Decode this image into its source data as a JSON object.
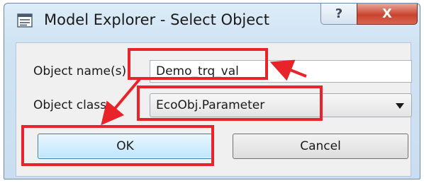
{
  "window": {
    "title": "Model Explorer - Select Object",
    "help_glyph": "?",
    "close_glyph": "X"
  },
  "form": {
    "name_label": "Object name(s):",
    "name_value": "Demo_trq_val",
    "class_label": "Object class:",
    "class_value": "EcoObj.Parameter"
  },
  "buttons": {
    "ok": "OK",
    "cancel": "Cancel"
  },
  "annotations": {
    "highlight_color": "#e8232a",
    "highlighted": [
      "name-input",
      "class-select",
      "ok-button"
    ]
  }
}
